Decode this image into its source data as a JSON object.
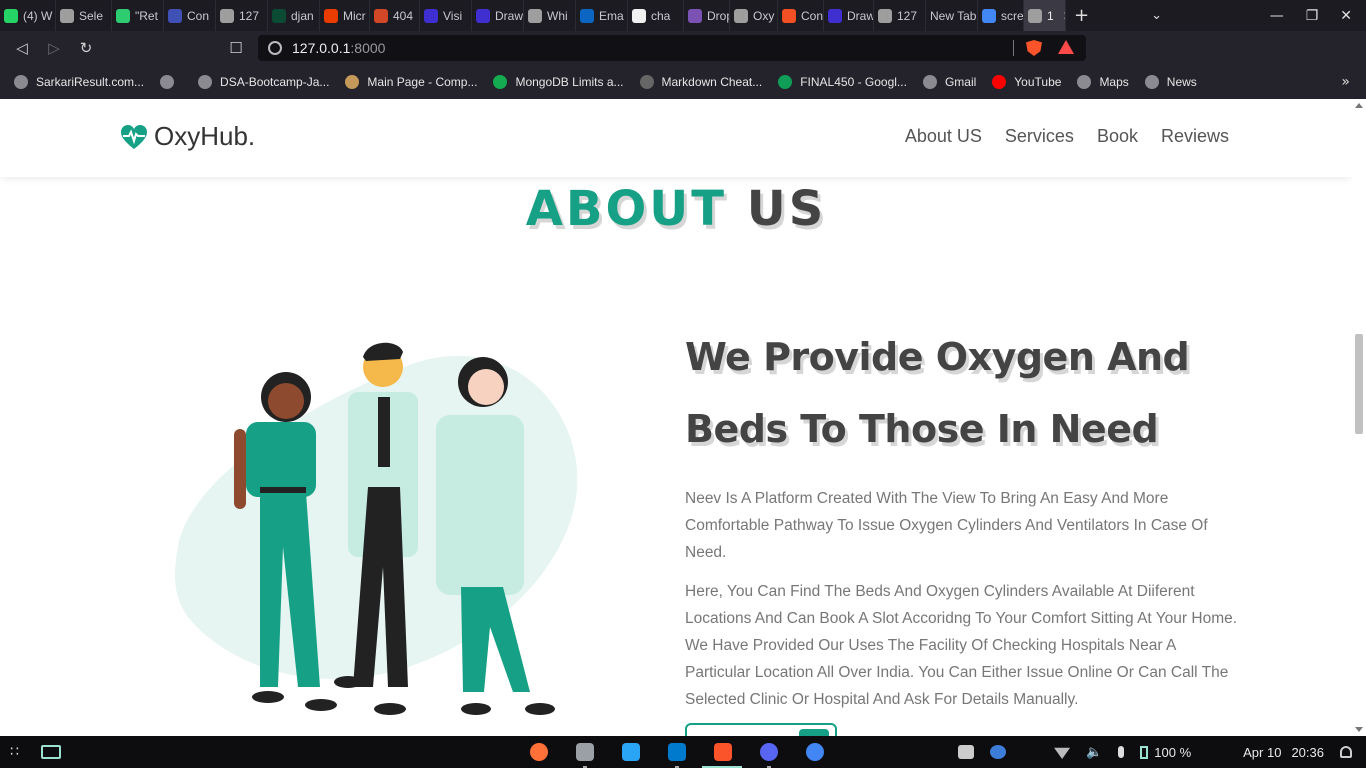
{
  "browser": {
    "tabs": [
      {
        "label": "(4) W",
        "color": "#25d366"
      },
      {
        "label": "Sele",
        "color": "#9e9e9e"
      },
      {
        "label": "\"Ret",
        "color": "#2ecc71"
      },
      {
        "label": "Con",
        "color": "#3f51b5"
      },
      {
        "label": "127",
        "color": "#9e9e9e"
      },
      {
        "label": "djan",
        "color": "#0c4b33"
      },
      {
        "label": "Micr",
        "color": "#eb3c00"
      },
      {
        "label": "404",
        "color": "#d24726"
      },
      {
        "label": "Visi",
        "color": "#3f2fd1"
      },
      {
        "label": "Draw",
        "color": "#3f2fd1"
      },
      {
        "label": "Whi",
        "color": "#9e9e9e"
      },
      {
        "label": "Ema",
        "color": "#0a66c2"
      },
      {
        "label": "cha",
        "color": "#f0f0f0"
      },
      {
        "label": "Drop",
        "color": "#7952b3"
      },
      {
        "label": "Oxy",
        "color": "#9e9e9e"
      },
      {
        "label": "Con",
        "color": "#f25022"
      },
      {
        "label": "Draw",
        "color": "#3f2fd1"
      },
      {
        "label": "127",
        "color": "#9e9e9e"
      },
      {
        "label": "New Tab",
        "color": ""
      },
      {
        "label": "scre",
        "color": "#4285f4"
      },
      {
        "label": "1",
        "color": "#9e9e9e",
        "active": true
      }
    ],
    "url": "127.0.0.1",
    "url_port": ":8000",
    "bookmarks": [
      {
        "label": "SarkariResult.com..."
      },
      {
        "label": ""
      },
      {
        "label": "DSA-Bootcamp-Ja..."
      },
      {
        "label": "Main Page - Comp..."
      },
      {
        "label": "MongoDB Limits a..."
      },
      {
        "label": "Markdown Cheat..."
      },
      {
        "label": "FINAL450 - Googl..."
      },
      {
        "label": "Gmail"
      },
      {
        "label": "YouTube"
      },
      {
        "label": "Maps"
      },
      {
        "label": "News"
      }
    ]
  },
  "site": {
    "logo": "OxyHub.",
    "nav": [
      "About US",
      "Services",
      "Book",
      "Reviews"
    ],
    "heading_part1": "ABOUT",
    "heading_part2": "US",
    "headline": "We Provide Oxygen And Beds To Those In Need",
    "paragraph1": "Neev Is A Platform Created With The View To Bring An Easy And More Comfortable Pathway To Issue Oxygen Cylinders And Ventilators In Case Of Need.",
    "paragraph2": "Here, You Can Find The Beds And Oxygen Cylinders Available At Diiferent Locations And Can Book A Slot Accoridng To Your Comfort Sitting At Your Home. We Have Provided Our Uses The Facility Of Checking Hospitals Near A Particular Location All Over India. You Can Either Issue Online Or Can Call The Selected Clinic Or Hospital And Ask For Details Manually.",
    "accent_color": "#16a085"
  },
  "taskbar": {
    "battery": "100 %",
    "date": "Apr 10",
    "time": "20:36"
  }
}
